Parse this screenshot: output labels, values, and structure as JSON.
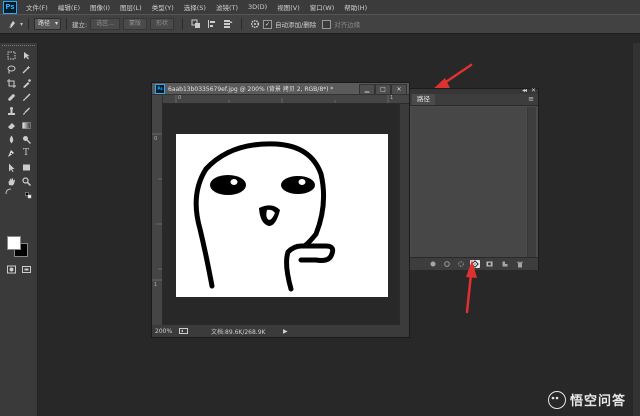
{
  "menubar": {
    "logo": "Ps",
    "items": [
      "文件(F)",
      "编辑(E)",
      "图像(I)",
      "图层(L)",
      "类型(Y)",
      "选择(S)",
      "滤镜(T)",
      "3D(D)",
      "视图(V)",
      "窗口(W)",
      "帮助(H)"
    ]
  },
  "options": {
    "mode_select": "路径",
    "make_label": "建立:",
    "selection_button": "选区...",
    "mask_button": "蒙版",
    "shape_button": "形状",
    "auto_add_delete_label": "自动添加/删除",
    "auto_add_delete_checked": true,
    "align_edges_label": "对齐边缘",
    "align_edges_checked": false
  },
  "document": {
    "title": "6aab13b0335679ef.jpg @ 200% (背景 拷贝 2, RGB/8*) *",
    "zoom": "200%",
    "doc_info": "文档:89.6K/268.9K",
    "ruler_h_labels": [
      "0",
      "1"
    ],
    "ruler_v_labels": [
      "0",
      "1"
    ]
  },
  "paths_panel": {
    "tab": "路径",
    "menu_glyph": "≡"
  },
  "watermark": {
    "text": "悟空问答"
  },
  "colors": {
    "foreground": "#ffffff",
    "background": "#000000",
    "arrow": "#e03030",
    "ps_blue": "#31a8ff"
  }
}
